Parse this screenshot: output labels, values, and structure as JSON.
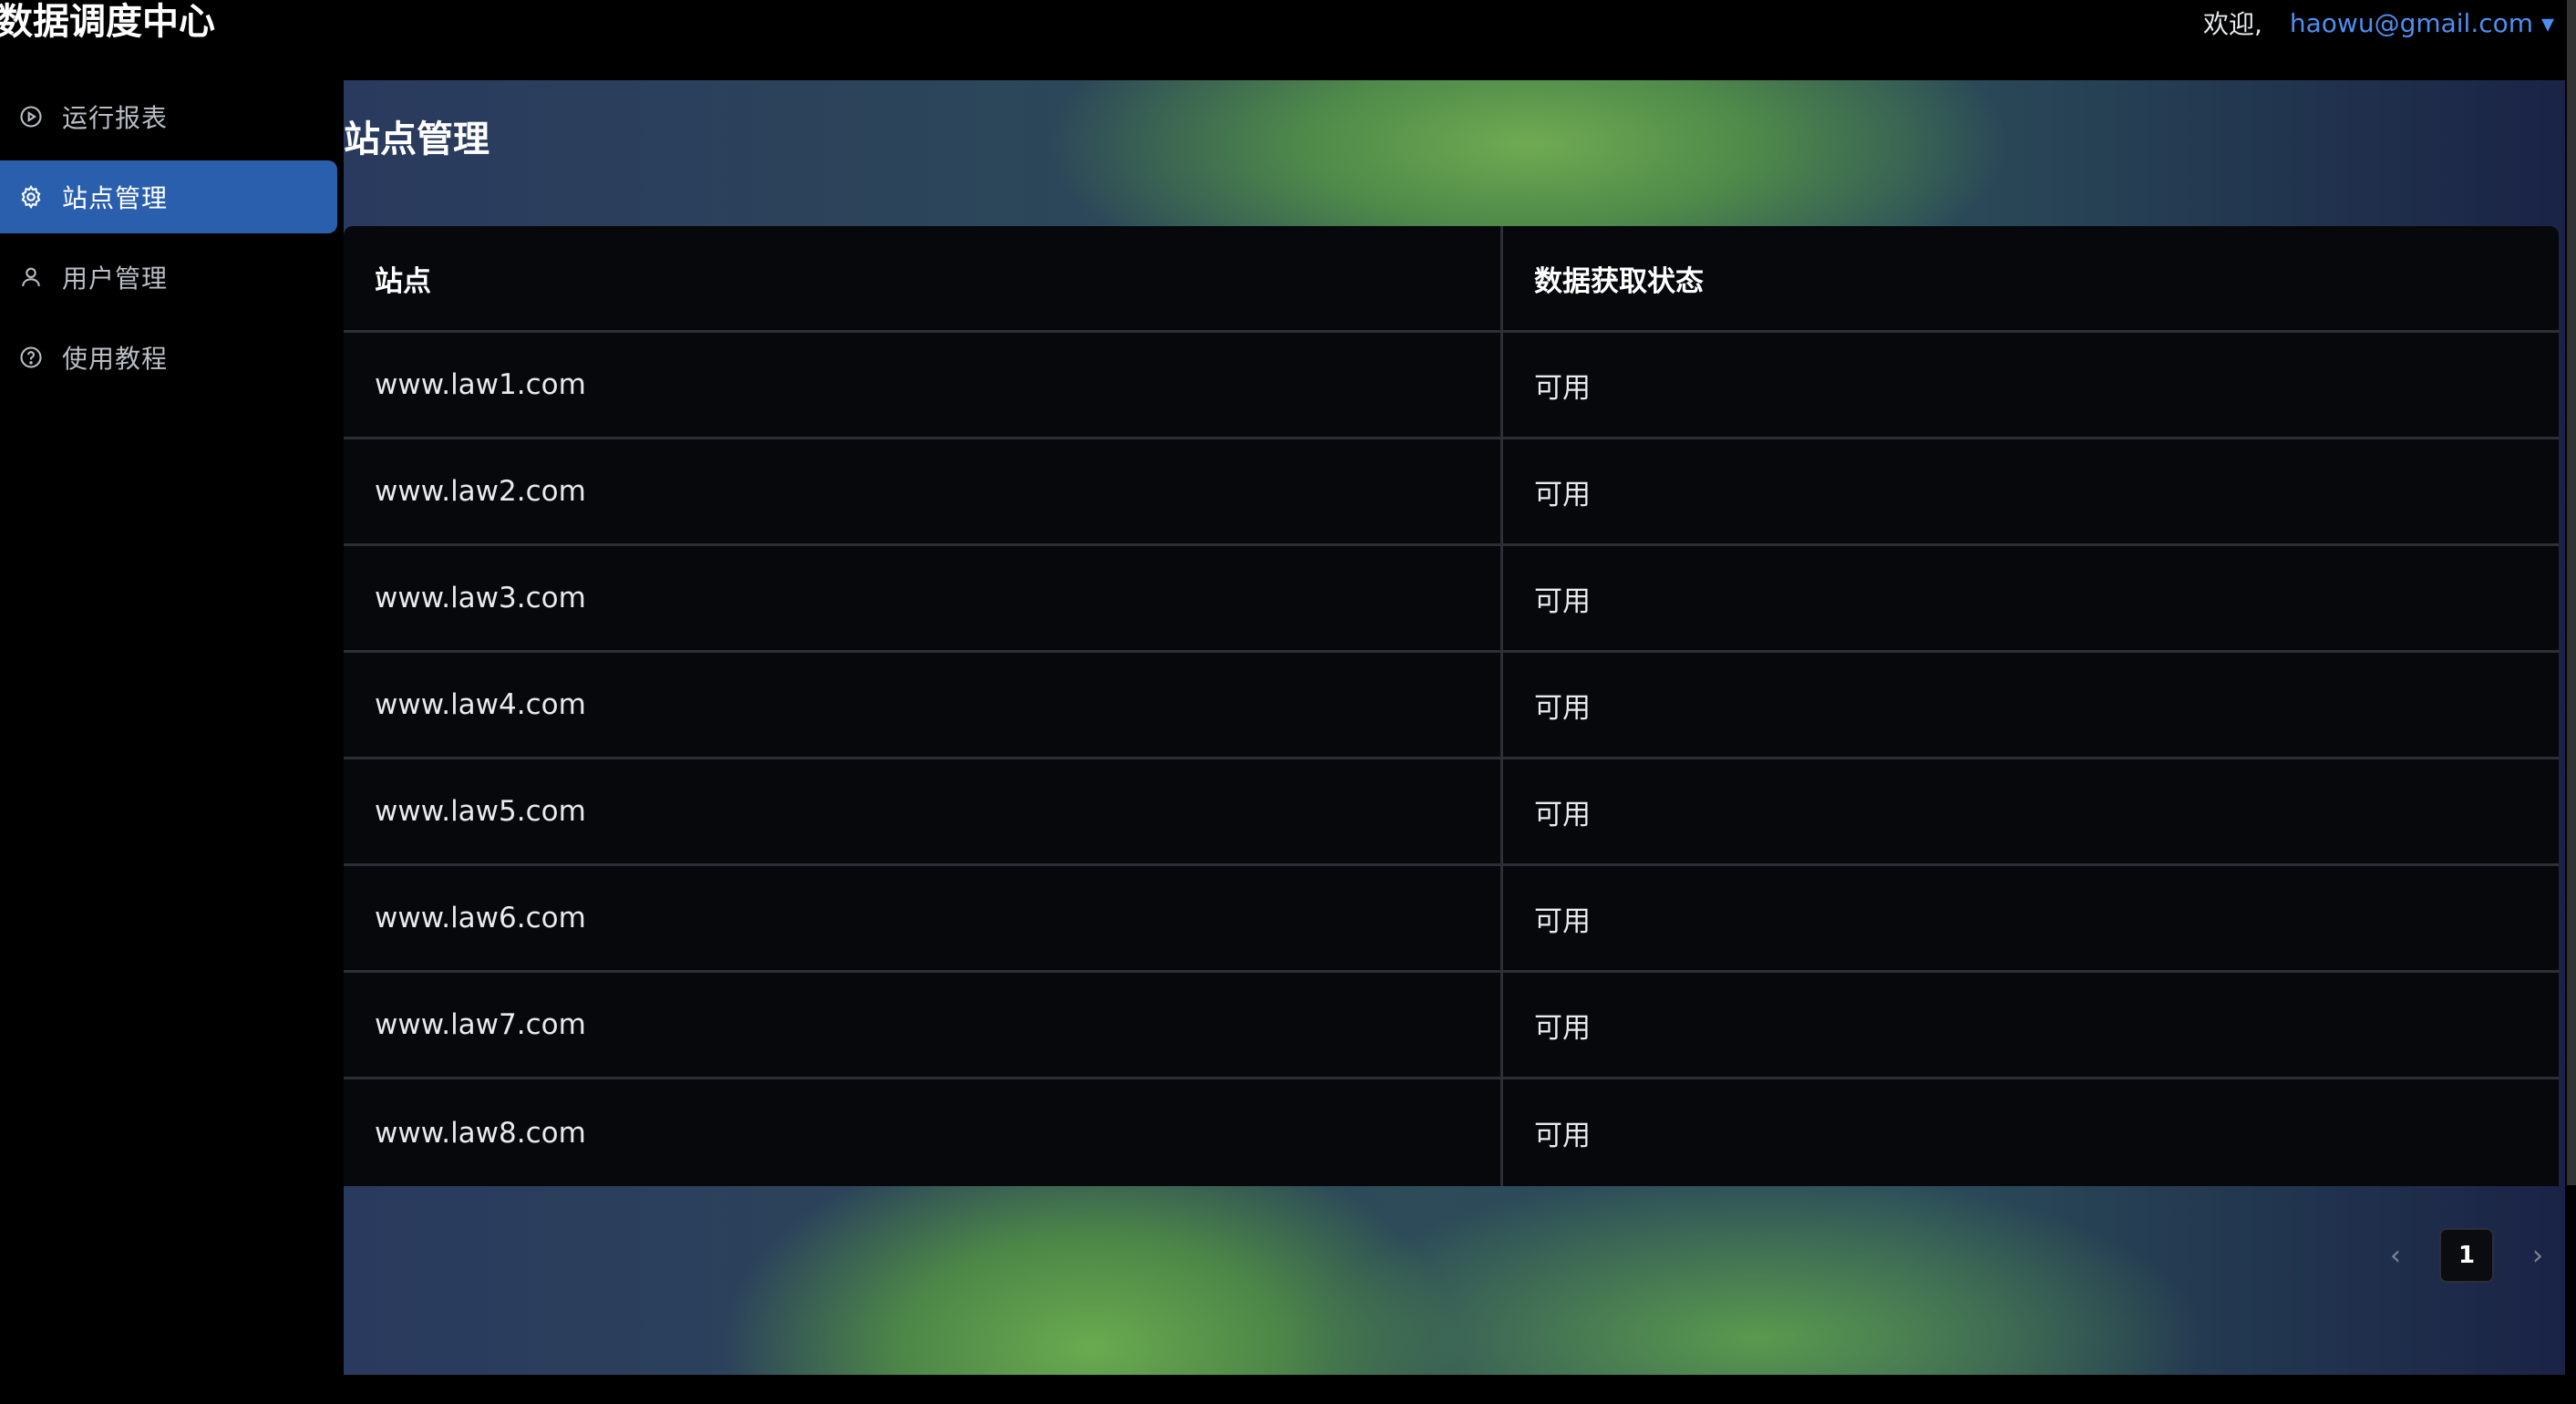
{
  "app": {
    "title": "数据调度中心"
  },
  "header": {
    "welcome": "欢迎,",
    "user": "haowu@gmail.com ▾"
  },
  "sidebar": {
    "items": [
      {
        "label": "运行报表",
        "icon": "play-circle-icon",
        "active": false
      },
      {
        "label": "站点管理",
        "icon": "gear-icon",
        "active": true
      },
      {
        "label": "用户管理",
        "icon": "user-icon",
        "active": false
      },
      {
        "label": "使用教程",
        "icon": "help-circle-icon",
        "active": false
      }
    ]
  },
  "main": {
    "title": "站点管理",
    "table": {
      "columns": [
        "站点",
        "数据获取状态"
      ],
      "rows": [
        [
          "www.law1.com",
          "可用"
        ],
        [
          "www.law2.com",
          "可用"
        ],
        [
          "www.law3.com",
          "可用"
        ],
        [
          "www.law4.com",
          "可用"
        ],
        [
          "www.law5.com",
          "可用"
        ],
        [
          "www.law6.com",
          "可用"
        ],
        [
          "www.law7.com",
          "可用"
        ],
        [
          "www.law8.com",
          "可用"
        ]
      ]
    },
    "pagination": {
      "prev": "‹",
      "current": "1",
      "next": "›"
    }
  },
  "colors": {
    "accent": "#2a5fae",
    "link": "#4d8ff0",
    "table_bg": "#07080c"
  }
}
